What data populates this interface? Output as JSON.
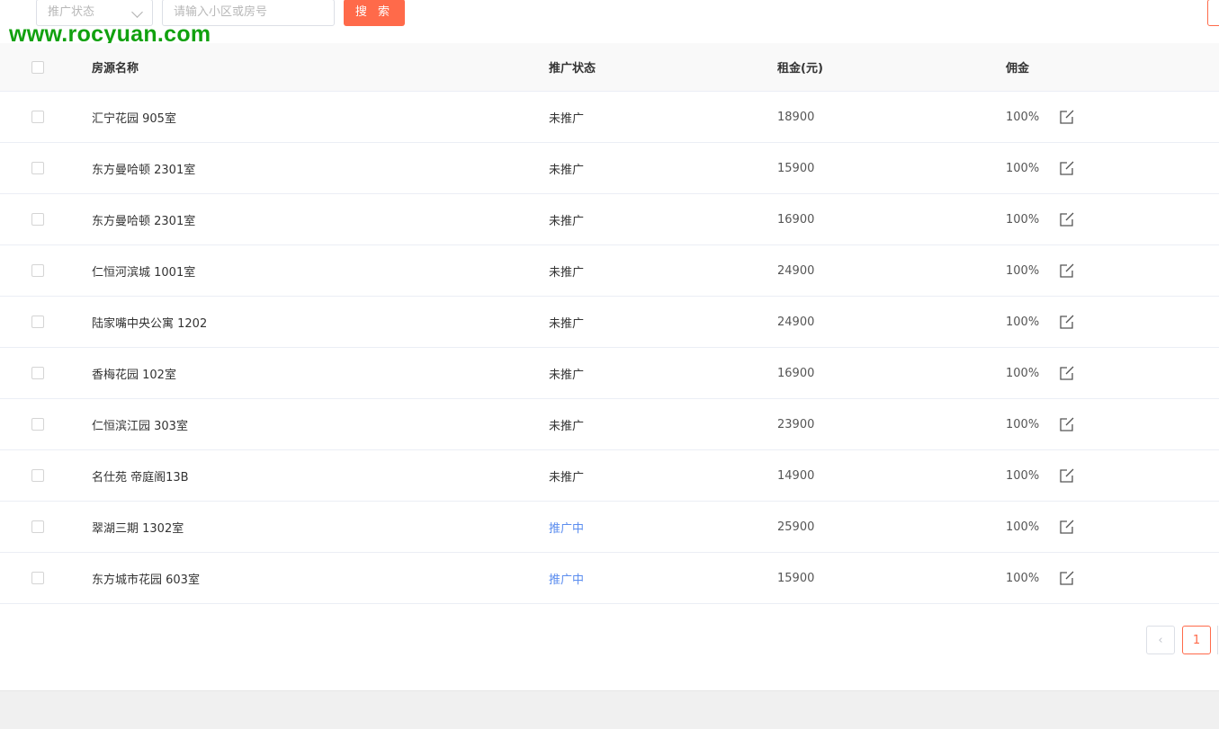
{
  "filters": {
    "status_placeholder": "推广状态",
    "search_placeholder": "请输入小区或房号",
    "search_button": "搜 索"
  },
  "watermark": "www.rocyuan.com",
  "table": {
    "headers": {
      "name": "房源名称",
      "status": "推广状态",
      "rent": "租金(元)",
      "commission": "佣金"
    },
    "rows": [
      {
        "name": "汇宁花园 905室",
        "status": "未推广",
        "rent": "18900",
        "commission": "100%"
      },
      {
        "name": "东方曼哈顿 2301室",
        "status": "未推广",
        "rent": "15900",
        "commission": "100%"
      },
      {
        "name": "东方曼哈顿 2301室",
        "status": "未推广",
        "rent": "16900",
        "commission": "100%"
      },
      {
        "name": "仁恒河滨城 1001室",
        "status": "未推广",
        "rent": "24900",
        "commission": "100%"
      },
      {
        "name": "陆家嘴中央公寓 1202",
        "status": "未推广",
        "rent": "24900",
        "commission": "100%"
      },
      {
        "name": "香梅花园 102室",
        "status": "未推广",
        "rent": "16900",
        "commission": "100%"
      },
      {
        "name": "仁恒滨江园 303室",
        "status": "未推广",
        "rent": "23900",
        "commission": "100%"
      },
      {
        "name": "名仕苑 帝庭阁13B",
        "status": "未推广",
        "rent": "14900",
        "commission": "100%"
      },
      {
        "name": "翠湖三期 1302室",
        "status": "推广中",
        "rent": "25900",
        "commission": "100%"
      },
      {
        "name": "东方城市花园 603室",
        "status": "推广中",
        "rent": "15900",
        "commission": "100%"
      }
    ]
  },
  "pagination": {
    "prev_icon": "chevron-left-icon",
    "prev_glyph": "‹",
    "current_page": "1"
  },
  "colors": {
    "accent": "#ff6a4a",
    "active_status": "#5b8def",
    "watermark": "#11a10f"
  }
}
